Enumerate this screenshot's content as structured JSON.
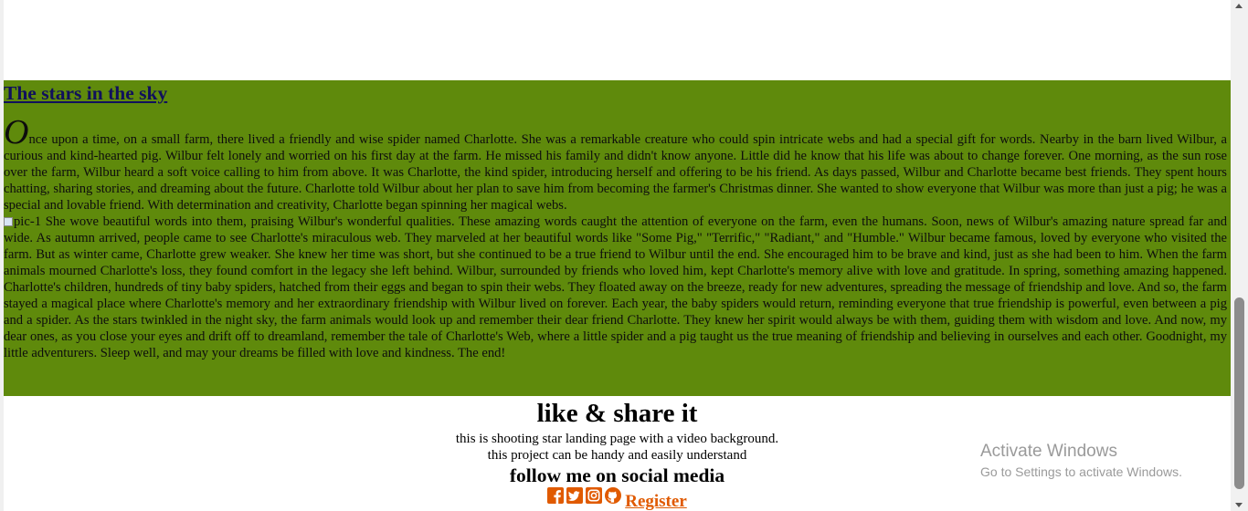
{
  "story": {
    "title": "The stars in the sky",
    "dropcap": "O",
    "paragraph_1": "nce upon a time, on a small farm, there lived a friendly and wise spider named Charlotte. She was a remarkable creature who could spin intricate webs and had a special gift for words. Nearby in the barn lived Wilbur, a curious and kind-hearted pig. Wilbur felt lonely and worried on his first day at the farm. He missed his family and didn't know anyone. Little did he know that his life was about to change forever. One morning, as the sun rose over the farm, Wilbur heard a soft voice calling to him from above. It was Charlotte, the kind spider, introducing herself and offering to be his friend. As days passed, Wilbur and Charlotte became best friends. They spent hours chatting, sharing stories, and dreaming about the future. Charlotte told Wilbur about her plan to save him from becoming the farmer's Christmas dinner. She wanted to show everyone that Wilbur was more than just a pig; he was a special and lovable friend. With determination and creativity, Charlotte began spinning her magical webs.",
    "image_alt": "pic-1",
    "paragraph_2": " She wove beautiful words into them, praising Wilbur's wonderful qualities. These amazing words caught the attention of everyone on the farm, even the humans. Soon, news of Wilbur's amazing nature spread far and wide. As autumn arrived, people came to see Charlotte's miraculous web. They marveled at her beautiful words like \"Some Pig,\" \"Terrific,\" \"Radiant,\" and \"Humble.\" Wilbur became famous, loved by everyone who visited the farm. But as winter came, Charlotte grew weaker. She knew her time was short, but she continued to be a true friend to Wilbur until the end. She encouraged him to be brave and kind, just as she had been to him. When the farm animals mourned Charlotte's loss, they found comfort in the legacy she left behind. Wilbur, surrounded by friends who loved him, kept Charlotte's memory alive with love and gratitude. In spring, something amazing happened. Charlotte's children, hundreds of tiny baby spiders, hatched from their eggs and began to spin their webs. They floated away on the breeze, ready for new adventures, spreading the message of friendship and love. And so, the farm stayed a magical place where Charlotte's memory and her extraordinary friendship with Wilbur lived on forever. Each year, the baby spiders would return, reminding everyone that true friendship is powerful, even between a pig and a spider. As the stars twinkled in the night sky, the farm animals would look up and remember their dear friend Charlotte. They knew her spirit would always be with them, guiding them with wisdom and love. And now, my dear ones, as you close your eyes and drift off to dreamland, remember the tale of Charlotte's Web, where a little spider and a pig taught us the true meaning of friendship and believing in ourselves and each other. Goodnight, my little adventurers. Sleep well, and may your dreams be filled with love and kindness. The end!",
    "background_color": "#5f8a0c",
    "title_color": "#10105c"
  },
  "footer": {
    "heading": "like & share it",
    "line_1": "this is shooting star landing page with a video background.",
    "line_2": "this project can be handy and easily understand",
    "social_heading": "follow me on social media",
    "social_icons": [
      "facebook-icon",
      "twitter-icon",
      "instagram-icon",
      "github-icon"
    ],
    "register_label": "Register",
    "accent_color": "#e05a00"
  },
  "watermark": {
    "title": "Activate Windows",
    "subtitle": "Go to Settings to activate Windows."
  }
}
